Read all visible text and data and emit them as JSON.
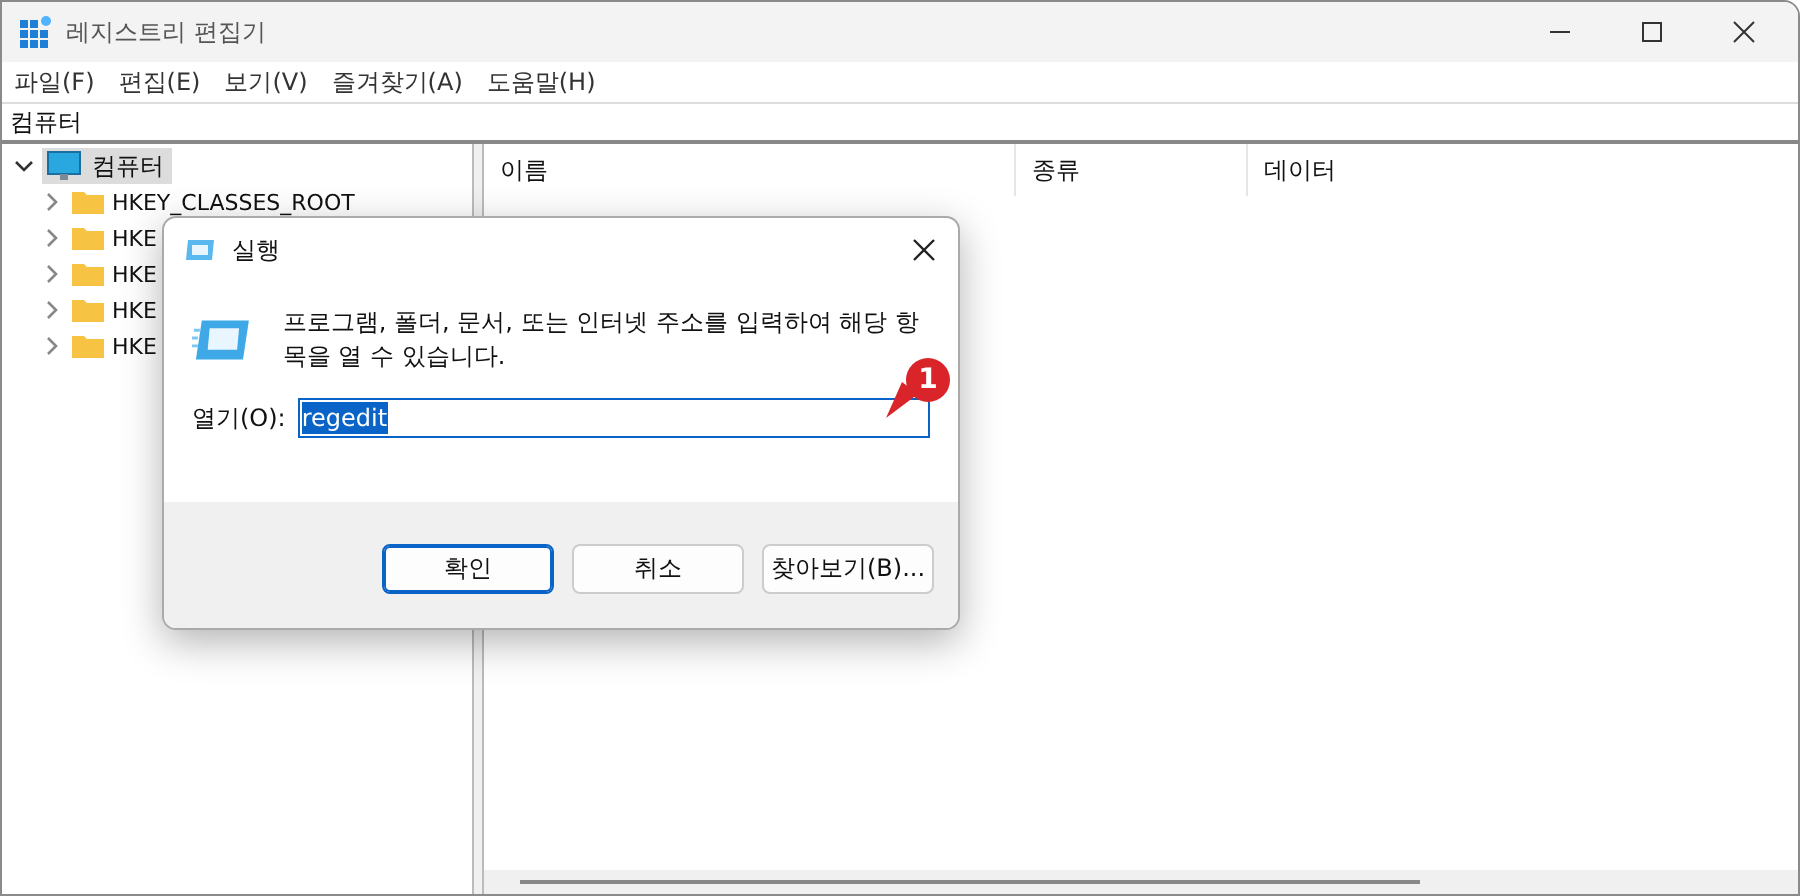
{
  "window": {
    "title": "레지스트리 편집기"
  },
  "menu": [
    "파일(F)",
    "편집(E)",
    "보기(V)",
    "즐겨찾기(A)",
    "도움말(H)"
  ],
  "address_bar": {
    "value": "컴퓨터"
  },
  "tree": [
    {
      "label": "컴퓨터",
      "kind": "computer",
      "expanded": true,
      "selected": true,
      "children": [
        {
          "label": "HKEY_CLASSES_ROOT",
          "kind": "folder",
          "expanded": false,
          "selected": false
        },
        {
          "label": "HKE",
          "kind": "folder",
          "expanded": false,
          "selected": false
        },
        {
          "label": "HKE",
          "kind": "folder",
          "expanded": false,
          "selected": false
        },
        {
          "label": "HKE",
          "kind": "folder",
          "expanded": false,
          "selected": false
        },
        {
          "label": "HKE",
          "kind": "folder",
          "expanded": false,
          "selected": false
        }
      ]
    }
  ],
  "table": {
    "columns": [
      "이름",
      "종류",
      "데이터"
    ]
  },
  "dialog": {
    "title": "실행",
    "description": "프로그램, 폴더, 문서, 또는 인터넷 주소를 입력하여 해당 항목을 열 수 있습니다.",
    "open_label": "열기(O):",
    "open_field": {
      "value": "regedit",
      "value_selected": true
    },
    "callout": "1",
    "buttons": [
      {
        "label": "확인",
        "default": true
      },
      {
        "label": "취소",
        "default": false
      },
      {
        "label": "찾아보기(B)...",
        "default": false
      }
    ]
  }
}
